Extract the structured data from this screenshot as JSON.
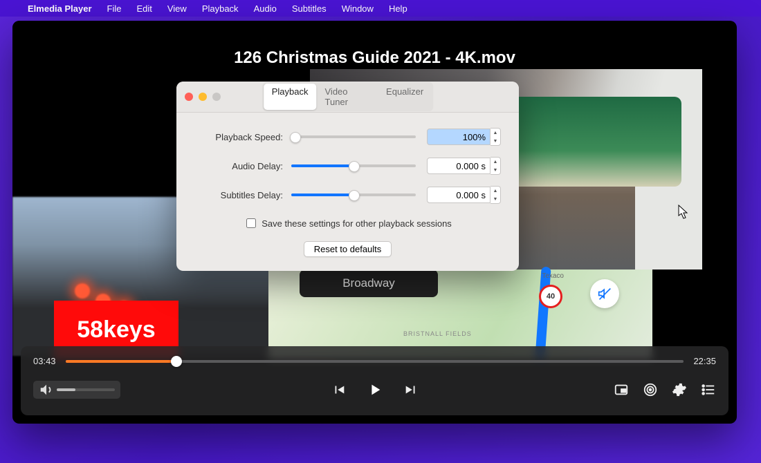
{
  "menubar": {
    "app": "Elmedia Player",
    "items": [
      "File",
      "Edit",
      "View",
      "Playback",
      "Audio",
      "Subtitles",
      "Window",
      "Help"
    ]
  },
  "player": {
    "title": "126 Christmas Guide 2021 - 4K.mov",
    "badge": "58keys",
    "broadway": "Broadway",
    "map_label": "BRISTNALL FIELDS",
    "map_speed": "40",
    "map_texaco": "Texaco",
    "time_elapsed": "03:43",
    "time_total": "22:35",
    "progress_pct": 18
  },
  "panel": {
    "tabs": [
      "Playback",
      "Video Tuner",
      "Equalizer"
    ],
    "active_tab": 0,
    "rows": {
      "speed": {
        "label": "Playback Speed:",
        "value": "100%",
        "slider_pct": 3,
        "blue": false
      },
      "audio": {
        "label": "Audio Delay:",
        "value": "0.000 s",
        "slider_pct": 50,
        "blue": true
      },
      "subtitles": {
        "label": "Subtitles Delay:",
        "value": "0.000 s",
        "slider_pct": 50,
        "blue": true
      }
    },
    "save_label": "Save these settings for other playback sessions",
    "reset_label": "Reset to defaults"
  }
}
